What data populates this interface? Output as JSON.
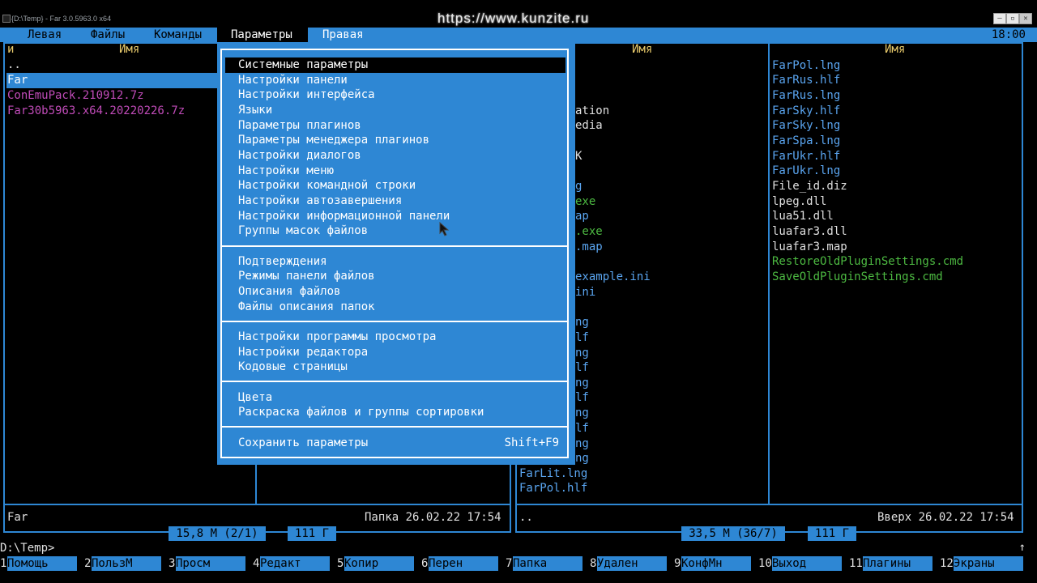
{
  "window": {
    "title": "{D:\\Temp} - Far 3.0.5963.0 x64",
    "overlay_url": "https://www.kunzite.ru",
    "buttons": [
      "–",
      "▫",
      "✕"
    ]
  },
  "menubar": {
    "items": [
      "Левая",
      "Файлы",
      "Команды",
      "Параметры",
      "Правая"
    ],
    "active": "Параметры",
    "clock": "18:00"
  },
  "left_panel": {
    "col_left": "и",
    "col_name": "Имя",
    "files": [
      {
        "name": "..",
        "style": "white"
      },
      {
        "name": "Far",
        "style": "sel"
      },
      {
        "name": "ConEmuPack.210912.7z",
        "style": "magenta"
      },
      {
        "name": "Far30b5963.x64.20220226.7z",
        "style": "magenta"
      }
    ],
    "info_name": "Far",
    "info_right": "Папка 26.02.22 17:54",
    "stat_size": "15,8 M (2/1)",
    "stat_free": "111 Г"
  },
  "right_panel": {
    "col_name_left": "Имя",
    "col_name_right": "Имя",
    "visible_fragments": [
      {
        "text": "ation",
        "style": "white"
      },
      {
        "text": "edia",
        "style": "white"
      },
      {
        "text": "K",
        "style": "white"
      },
      {
        "text": "g",
        "style": "lblue"
      },
      {
        "text": "exe",
        "style": "green"
      },
      {
        "text": "ap",
        "style": "lblue"
      },
      {
        "text": ".exe",
        "style": "green"
      },
      {
        "text": ".map",
        "style": "lblue"
      },
      {
        "text": "example.ini",
        "style": "lblue"
      },
      {
        "text": "ini",
        "style": "lblue"
      },
      {
        "text": "ng",
        "style": "lblue"
      },
      {
        "text": "lf",
        "style": "lblue"
      },
      {
        "text": "ng",
        "style": "lblue"
      },
      {
        "text": "lf",
        "style": "lblue"
      },
      {
        "text": "ng",
        "style": "lblue"
      },
      {
        "text": "lf",
        "style": "lblue"
      },
      {
        "text": "ng",
        "style": "lblue"
      },
      {
        "text": "lf",
        "style": "lblue"
      },
      {
        "text": "ng",
        "style": "lblue"
      },
      {
        "text": "ng",
        "style": "lblue"
      }
    ],
    "col1_bottom": [
      "FarLit.lng",
      "FarPol.hlf"
    ],
    "col2_files": [
      {
        "name": "FarPol.lng",
        "style": "lblue"
      },
      {
        "name": "FarRus.hlf",
        "style": "lblue"
      },
      {
        "name": "FarRus.lng",
        "style": "lblue"
      },
      {
        "name": "FarSky.hlf",
        "style": "lblue"
      },
      {
        "name": "FarSky.lng",
        "style": "lblue"
      },
      {
        "name": "FarSpa.lng",
        "style": "lblue"
      },
      {
        "name": "FarUkr.hlf",
        "style": "lblue"
      },
      {
        "name": "FarUkr.lng",
        "style": "lblue"
      },
      {
        "name": "File_id.diz",
        "style": "white"
      },
      {
        "name": "lpeg.dll",
        "style": "white"
      },
      {
        "name": "lua51.dll",
        "style": "white"
      },
      {
        "name": "luafar3.dll",
        "style": "white"
      },
      {
        "name": "luafar3.map",
        "style": "white"
      },
      {
        "name": "RestoreOldPluginSettings.cmd",
        "style": "green"
      },
      {
        "name": "SaveOldPluginSettings.cmd",
        "style": "green"
      }
    ],
    "info_name": "..",
    "info_right": "Вверх 26.02.22 17:54",
    "stat_size": "33,5 M (36/7)",
    "stat_free": "111 Г"
  },
  "dropdown": {
    "groups": [
      [
        "Системные параметры",
        "Настройки панели",
        "Настройки интерфейса",
        "Языки",
        "Параметры плагинов",
        "Параметры менеджера плагинов",
        "Настройки диалогов",
        "Настройки меню",
        "Настройки командной строки",
        "Настройки автозавершения",
        "Настройки информационной панели",
        "Группы масок файлов"
      ],
      [
        "Подтверждения",
        "Режимы панели файлов",
        "Описания файлов",
        "Файлы описания папок"
      ],
      [
        "Настройки программы просмотра",
        "Настройки редактора",
        "Кодовые страницы"
      ],
      [
        "Цвета",
        "Раскраска файлов и группы сортировки"
      ],
      [
        "Сохранить параметры"
      ]
    ],
    "save_shortcut": "Shift+F9",
    "selected": "Системные параметры"
  },
  "cmdline": {
    "prompt": "D:\\Temp>",
    "arrow": "↑"
  },
  "keybar": [
    {
      "num": "1",
      "label": "Помощь"
    },
    {
      "num": "2",
      "label": "ПользМ"
    },
    {
      "num": "3",
      "label": "Просм"
    },
    {
      "num": "4",
      "label": "Редакт"
    },
    {
      "num": "5",
      "label": "Копир"
    },
    {
      "num": "6",
      "label": "Перен"
    },
    {
      "num": "7",
      "label": "Папка"
    },
    {
      "num": "8",
      "label": "Удален"
    },
    {
      "num": "9",
      "label": "КонфМн"
    },
    {
      "num": "10",
      "label": "Выход"
    },
    {
      "num": "11",
      "label": "Плагины"
    },
    {
      "num": "12",
      "label": "Экраны"
    }
  ]
}
